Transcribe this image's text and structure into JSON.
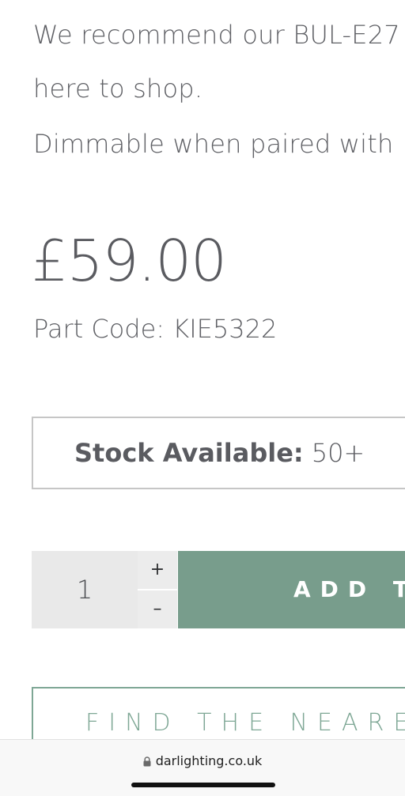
{
  "description": {
    "line1": "We recommend our BUL-E27",
    "line2": "here to shop.",
    "line3": "Dimmable when paired with"
  },
  "product": {
    "price": "£59.00",
    "part_code": "Part Code: KIE5322"
  },
  "stock": {
    "label": "Stock Available:",
    "value": "50+"
  },
  "quantity": {
    "value": "1",
    "plus": "+",
    "minus": "–"
  },
  "add_button": {
    "label": "ADD TO"
  },
  "find_button": {
    "label": "FIND THE NEAREST"
  },
  "browser": {
    "url": "darlighting.co.uk",
    "lock_icon": "lock-icon"
  },
  "colors": {
    "accent_green": "#789d8c",
    "outline_green": "#7ea795",
    "text_gray": "#5c5d62"
  }
}
